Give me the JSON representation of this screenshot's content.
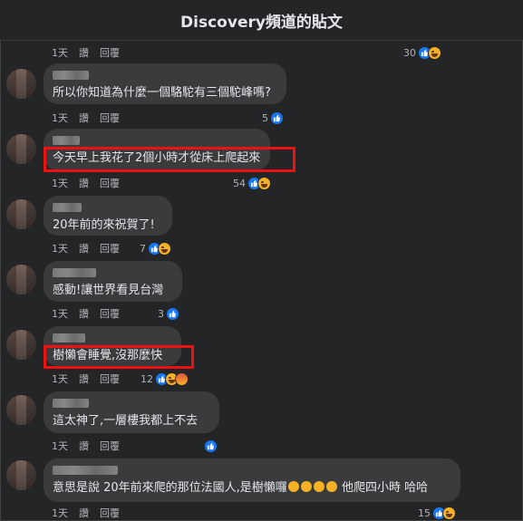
{
  "header": {
    "title": "Discovery頻道的貼文"
  },
  "action_labels": {
    "time": "1天",
    "like": "讚",
    "reply": "回覆"
  },
  "comments": [
    {
      "text": "",
      "count": "30"
    },
    {
      "text": "所以你知道為什麼一個駱駝有三個駝峰嗎?",
      "count": "5"
    },
    {
      "text": "今天早上我花了2個小時才從床上爬起來",
      "count": "54"
    },
    {
      "text": "20年前的來祝賀了!",
      "count": "7"
    },
    {
      "text": "感動!讓世界看見台灣",
      "count": "3"
    },
    {
      "text": "樹懶會睡覺,沒那麼快",
      "count": "12"
    },
    {
      "text": "這太神了,一層樓我都上不去",
      "count": ""
    },
    {
      "text_a": "意思是說 20年前來爬的那位法國人,是樹懶囉",
      "text_b": "他爬四小時 哈哈",
      "count": "15"
    }
  ]
}
